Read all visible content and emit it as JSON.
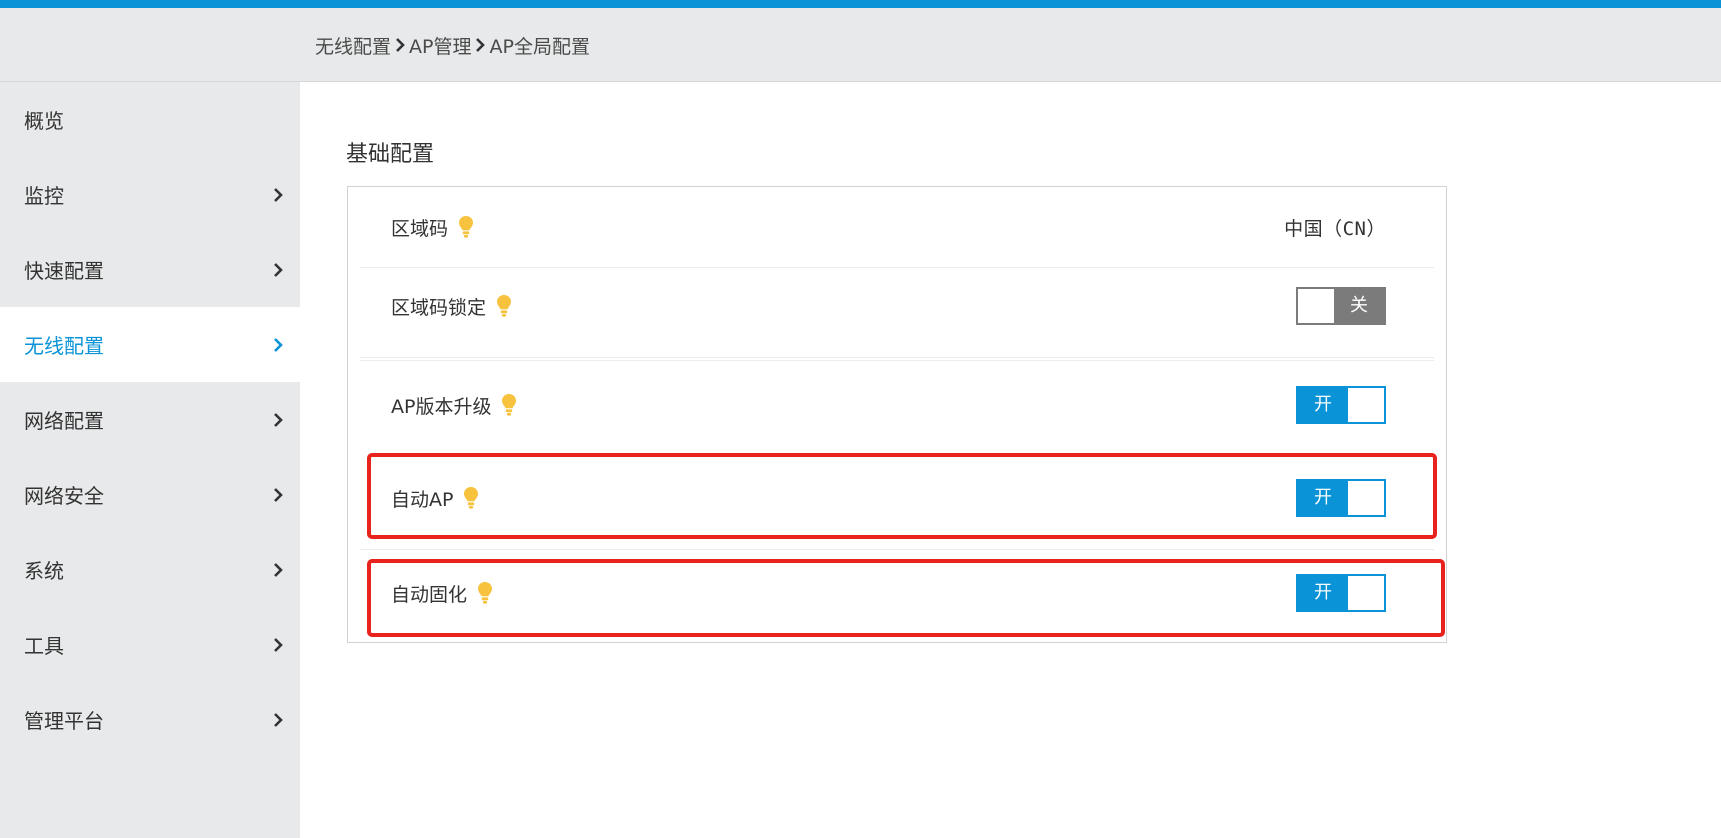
{
  "colors": {
    "accent": "#0a93d6",
    "highlight": "#e8231e",
    "bulb": "#f7c23e",
    "toggle_off": "#7b7b7b"
  },
  "breadcrumb": [
    "无线配置",
    "AP管理",
    "AP全局配置"
  ],
  "sidebar": {
    "items": [
      {
        "label": "概览"
      },
      {
        "label": "监控"
      },
      {
        "label": "快速配置"
      },
      {
        "label": "无线配置"
      },
      {
        "label": "网络配置"
      },
      {
        "label": "网络安全"
      },
      {
        "label": "系统"
      },
      {
        "label": "工具"
      },
      {
        "label": "管理平台"
      }
    ],
    "active": "无线配置"
  },
  "section": {
    "title": "基础配置",
    "rows": [
      {
        "label": "区域码",
        "value": "中国（CN）"
      },
      {
        "label": "区域码锁定",
        "toggle_text": "关",
        "state": "off"
      },
      {
        "label": "AP版本升级",
        "toggle_text": "开",
        "state": "on"
      },
      {
        "label": "自动AP",
        "toggle_text": "开",
        "state": "on",
        "highlighted": true
      },
      {
        "label": "自动固化",
        "toggle_text": "开",
        "state": "on",
        "highlighted": true
      }
    ]
  }
}
